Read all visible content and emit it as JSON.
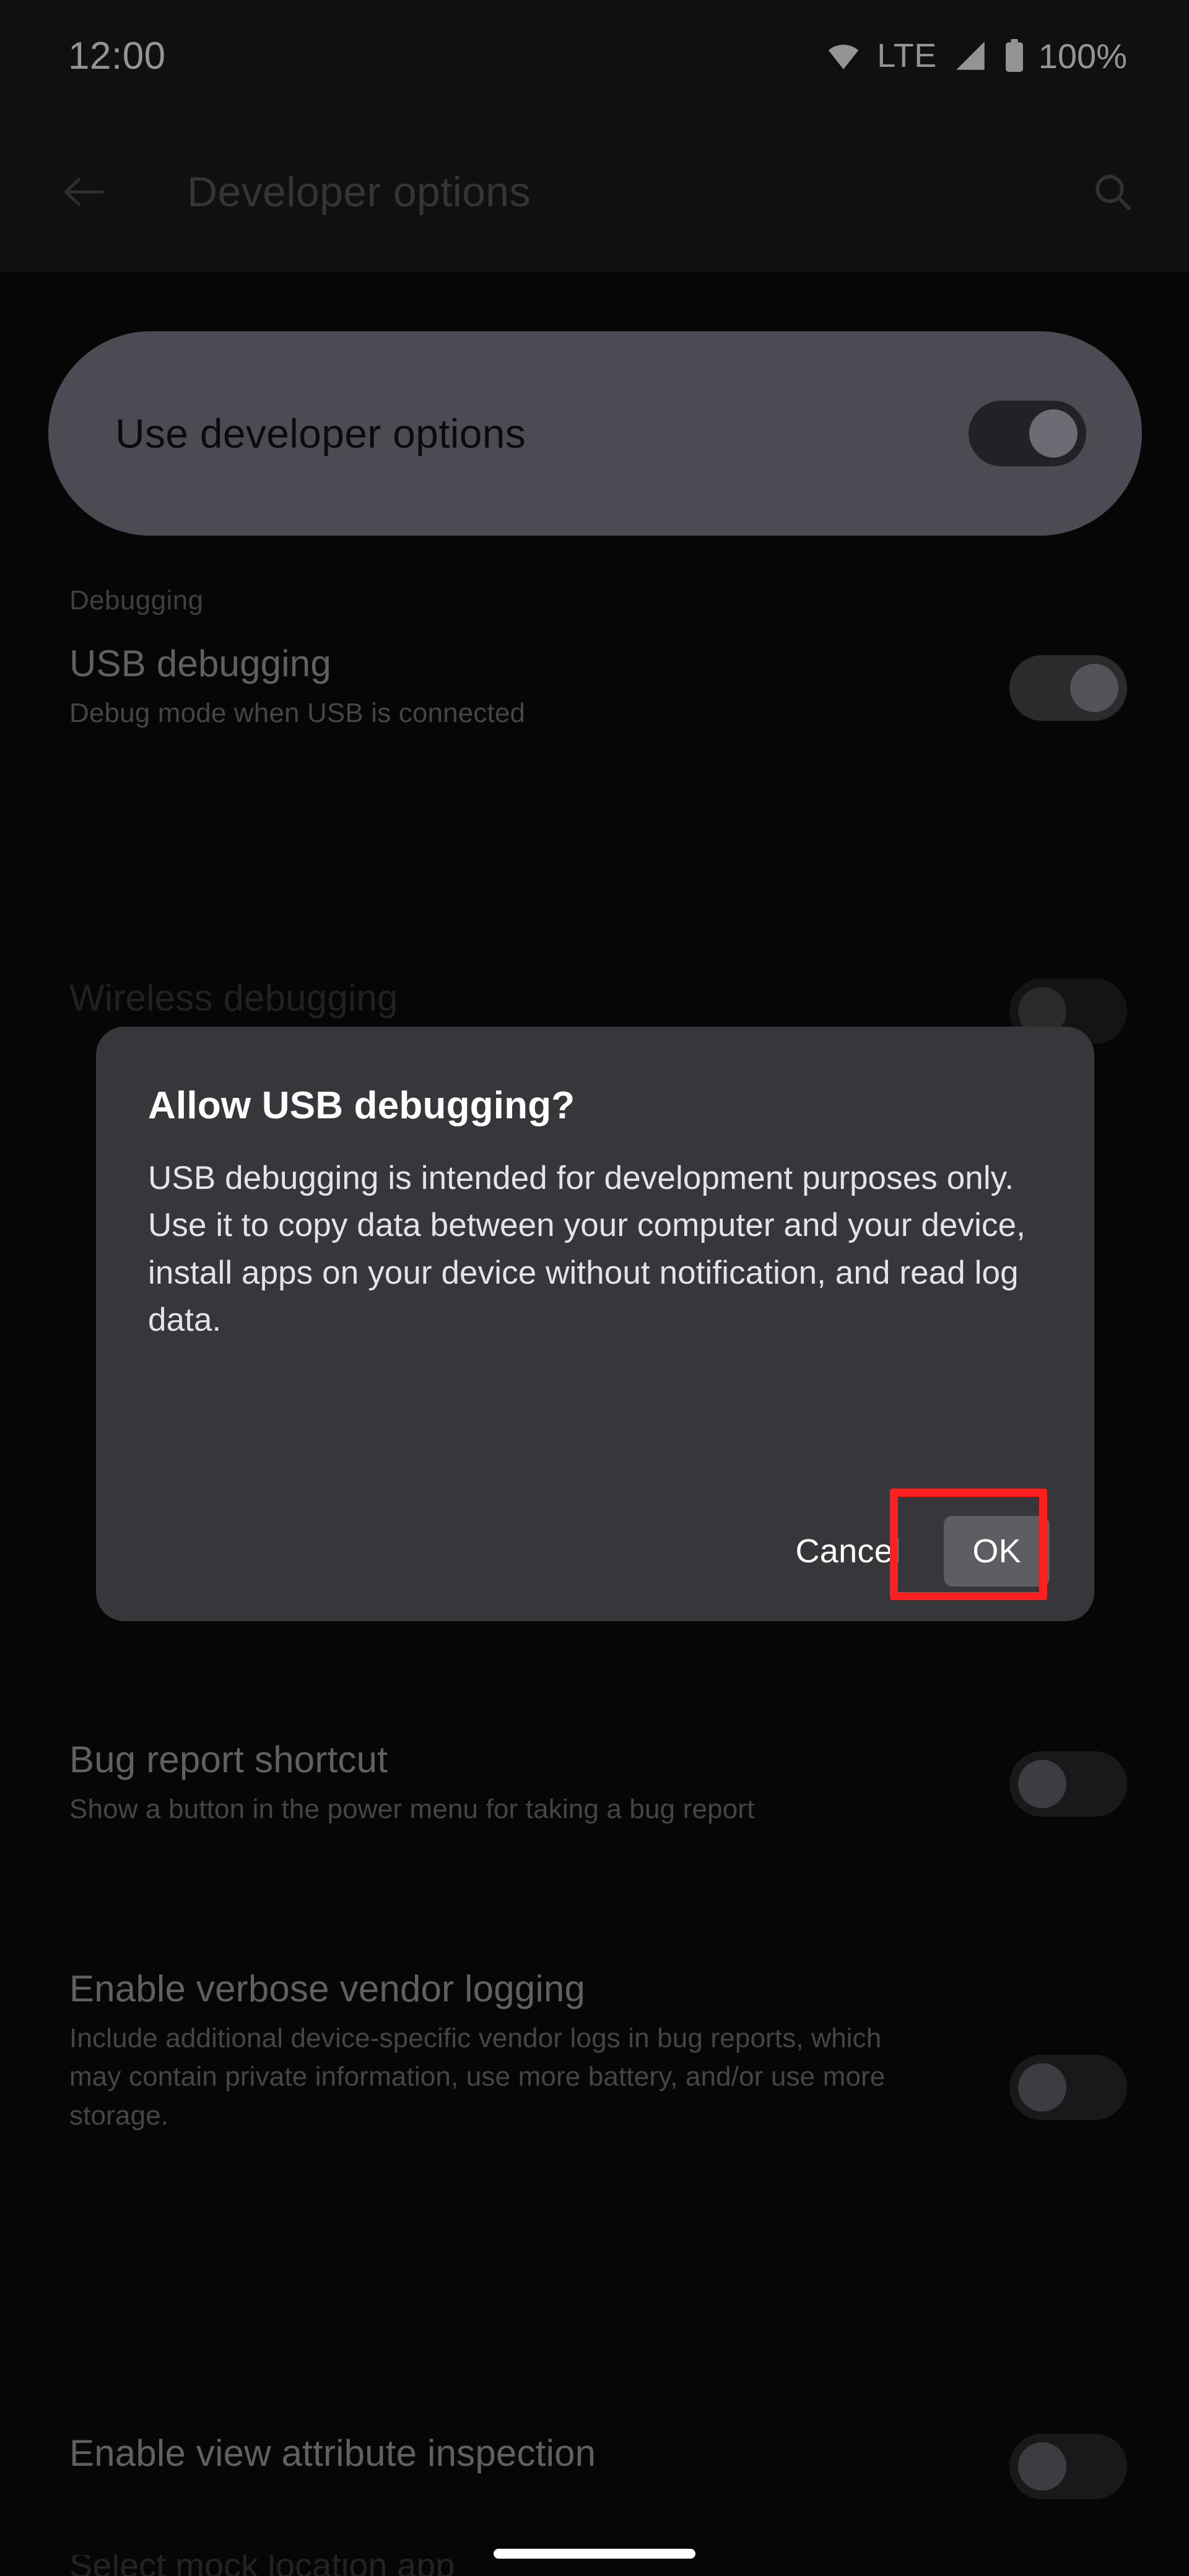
{
  "status_bar": {
    "clock": "12:00",
    "network_type": "LTE",
    "battery_percent": "100%",
    "icons": [
      "wifi-icon",
      "signal-icon",
      "battery-icon"
    ]
  },
  "app_bar": {
    "back_icon": "back-arrow-icon",
    "title": "Developer options",
    "search_icon": "search-icon"
  },
  "master_switch": {
    "label": "Use developer options",
    "state": "on"
  },
  "sections": [
    {
      "header": "Debugging"
    }
  ],
  "settings": [
    {
      "title": "USB debugging",
      "subtitle": "Debug mode when USB is connected",
      "state": "on"
    },
    {
      "title": "Wireless debugging",
      "subtitle": "",
      "state": "off"
    },
    {
      "title": "Bug report shortcut",
      "subtitle": "Show a button in the power menu for taking a bug report",
      "state": "off"
    },
    {
      "title": "Enable verbose vendor logging",
      "subtitle": "Include additional device-specific vendor logs in bug reports, which may contain private information, use more battery, and/or use more storage.",
      "state": "off"
    },
    {
      "title": "Enable view attribute inspection",
      "subtitle": "",
      "state": "off"
    }
  ],
  "dialog": {
    "title": "Allow USB debugging?",
    "body": "USB debugging is intended for development purposes only. Use it to copy data between your computer and your device, install apps on your device without notification, and read log data.",
    "cancel_label": "Cancel",
    "ok_label": "OK",
    "highlight_color": "#ff1f1f",
    "highlighted_button": "OK"
  },
  "colors": {
    "background": "#0b0b0c",
    "surface": "#1c1c1e",
    "dialog_surface": "#37373b",
    "master_card": "#82828f",
    "accent_text": "#ffffff",
    "annotation_red": "#ff1f1f"
  }
}
